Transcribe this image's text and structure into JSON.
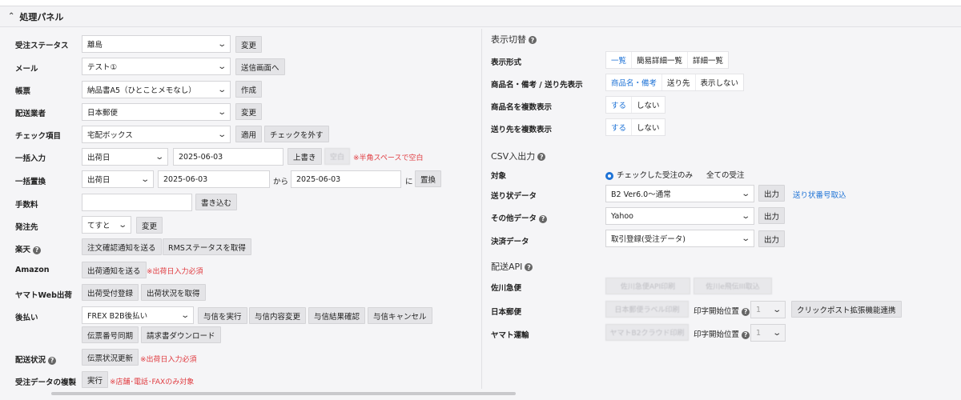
{
  "panel": {
    "title": "処理パネル"
  },
  "left": {
    "order_status": {
      "label": "受注ステータス",
      "value": "離島",
      "button": "変更"
    },
    "mail": {
      "label": "メール",
      "value": "テスト①",
      "button": "送信画面へ"
    },
    "form": {
      "label": "帳票",
      "value": "納品書A5（ひとことメモなし）",
      "button": "作成"
    },
    "carrier": {
      "label": "配送業者",
      "value": "日本郵便",
      "button": "変更"
    },
    "check_item": {
      "label": "チェック項目",
      "value": "宅配ボックス",
      "apply": "適用",
      "uncheck": "チェックを外す"
    },
    "bulk_input": {
      "label": "一括入力",
      "field": "出荷日",
      "date": "2025-06-03",
      "overwrite": "上書き",
      "blank": "空白",
      "note": "※半角スペースで空白"
    },
    "bulk_replace": {
      "label": "一括置換",
      "field": "出荷日",
      "from_date": "2025-06-03",
      "kara": "から",
      "to_date": "2025-06-03",
      "ni": "に",
      "replace": "置換"
    },
    "fee": {
      "label": "手数料",
      "value": "",
      "write": "書き込む"
    },
    "ship_from": {
      "label": "発注先",
      "value": "てすと",
      "button": "変更"
    },
    "rakuten": {
      "label": "楽天",
      "send": "注文確認通知を送る",
      "rms": "RMSステータスを取得"
    },
    "amazon": {
      "label": "Amazon",
      "send": "出荷通知を送る",
      "note": "※出荷日入力必須"
    },
    "yamato_web": {
      "label": "ヤマトWeb出荷",
      "register": "出荷受付登録",
      "status": "出荷状況を取得"
    },
    "deferred": {
      "label": "後払い",
      "value": "FREX B2B後払い",
      "buttons": [
        "与信を実行",
        "与信内容変更",
        "与信結果確認",
        "与信キャンセル"
      ],
      "buttons2": [
        "伝票番号同期",
        "請求書ダウンロード"
      ]
    },
    "delivery_status": {
      "label": "配送状況",
      "button": "伝票状況更新",
      "note": "※出荷日入力必須"
    },
    "duplicate": {
      "label": "受注データの複製",
      "button": "実行",
      "note": "※店舗･電話･FAXのみ対象"
    }
  },
  "right": {
    "display": {
      "title": "表示切替",
      "format": {
        "label": "表示形式",
        "options": [
          "一覧",
          "簡易詳細一覧",
          "詳細一覧"
        ]
      },
      "product_note": {
        "label": "商品名・備考 / 送り先表示",
        "options": [
          "商品名・備考",
          "送り先",
          "表示しない"
        ]
      },
      "multi_product": {
        "label": "商品名を複数表示",
        "options": [
          "する",
          "しない"
        ]
      },
      "multi_dest": {
        "label": "送り先を複数表示",
        "options": [
          "する",
          "しない"
        ]
      }
    },
    "csv": {
      "title": "CSV入出力",
      "target": {
        "label": "対象",
        "options": [
          "チェックした受注のみ",
          "全ての受注"
        ]
      },
      "shipping_label": {
        "label": "送り状データ",
        "value": "B2 Ver6.0～通常",
        "button": "出力",
        "link": "送り状番号取込"
      },
      "other": {
        "label": "その他データ",
        "value": "Yahoo",
        "button": "出力"
      },
      "payment": {
        "label": "決済データ",
        "value": "取引登録(受注データ)",
        "button": "出力"
      }
    },
    "api": {
      "title": "配送API",
      "sagawa": {
        "label": "佐川急便",
        "b1": "佐川急便API印刷",
        "b2": "佐川e飛伝III取込"
      },
      "japanpost": {
        "label": "日本郵便",
        "b1": "日本郵便ラベル印刷",
        "print_pos": "印字開始位置",
        "pos_value": "1",
        "clickpost": "クリックポスト拡張機能連携"
      },
      "yamato": {
        "label": "ヤマト運輸",
        "b1": "ヤマトB2クラウド印刷",
        "print_pos": "印字開始位置",
        "pos_value": "1"
      }
    }
  }
}
